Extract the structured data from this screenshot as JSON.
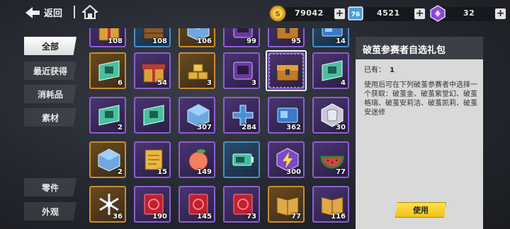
{
  "topbar": {
    "back_label": "返回",
    "resources": [
      {
        "name": "gold-coin",
        "value": "79042"
      },
      {
        "name": "ticket",
        "value": "4521"
      },
      {
        "name": "crystal",
        "value": "32"
      }
    ]
  },
  "sidebar": {
    "items": [
      {
        "label": "全部",
        "active": true
      },
      {
        "label": "最近获得",
        "active": false
      },
      {
        "label": "消耗品",
        "active": false
      },
      {
        "label": "素材",
        "active": false
      }
    ],
    "lower_items": [
      {
        "label": "零件"
      },
      {
        "label": "外观"
      }
    ]
  },
  "inventory": {
    "rows": [
      [
        {
          "qty": "108",
          "rarity": "purple",
          "icon": "gift-box-icon"
        },
        {
          "qty": "108",
          "rarity": "blue",
          "icon": "crate-icon"
        },
        {
          "qty": "106",
          "rarity": "gold",
          "icon": "cube-icon"
        },
        {
          "qty": "99",
          "rarity": "purple",
          "icon": "scanner-icon"
        },
        {
          "qty": "95",
          "rarity": "purple",
          "icon": "chest-icon"
        },
        {
          "qty": "14",
          "rarity": "blue",
          "icon": "card-icon"
        }
      ],
      [
        {
          "qty": "6",
          "rarity": "gold",
          "icon": "ticket-icon"
        },
        {
          "qty": "54",
          "rarity": "purple",
          "icon": "gift-box-icon"
        },
        {
          "qty": "3",
          "rarity": "gold",
          "icon": "gold-bricks-icon"
        },
        {
          "qty": "3",
          "rarity": "purple",
          "icon": "scanner-icon"
        },
        {
          "qty": "",
          "rarity": "purple",
          "icon": "chest-icon"
        },
        {
          "qty": "4",
          "rarity": "purple",
          "icon": "ticket-icon"
        }
      ],
      [
        {
          "qty": "2",
          "rarity": "purple",
          "icon": "ticket-icon"
        },
        {
          "qty": "",
          "rarity": "purple",
          "icon": "ticket-icon"
        },
        {
          "qty": "307",
          "rarity": "purple",
          "icon": "cube-icon"
        },
        {
          "qty": "284",
          "rarity": "purple",
          "icon": "cross-chip-icon"
        },
        {
          "qty": "362",
          "rarity": "purple",
          "icon": "card-icon"
        },
        {
          "qty": "30",
          "rarity": "purple",
          "icon": "hexagon-shirt-icon"
        }
      ],
      [
        {
          "qty": "2",
          "rarity": "gold",
          "icon": "cube-icon"
        },
        {
          "qty": "15",
          "rarity": "purple",
          "icon": "manual-icon"
        },
        {
          "qty": "149",
          "rarity": "purple",
          "icon": "peach-icon"
        },
        {
          "qty": "",
          "rarity": "blue",
          "icon": "battery-icon"
        },
        {
          "qty": "300",
          "rarity": "purple",
          "icon": "lightning-hex-icon"
        },
        {
          "qty": "77",
          "rarity": "purple",
          "icon": "watermelon-icon"
        }
      ],
      [
        {
          "qty": "36",
          "rarity": "gold",
          "icon": "snowflake-icon"
        },
        {
          "qty": "190",
          "rarity": "purple",
          "icon": "red-card-icon"
        },
        {
          "qty": "145",
          "rarity": "purple",
          "icon": "red-card-icon"
        },
        {
          "qty": "73",
          "rarity": "purple",
          "icon": "red-card-icon"
        },
        {
          "qty": "77",
          "rarity": "gold",
          "icon": "book-icon"
        },
        {
          "qty": "116",
          "rarity": "purple",
          "icon": "book-icon"
        }
      ]
    ]
  },
  "detail": {
    "title": "破茧参赛者自选礼包",
    "owned_label": "已有：",
    "owned_value": "1",
    "description": "使用后可在下列破茧参赛者中选择一个获取：破茧金、破茧紫堂幻、破茧格瑞、破茧安莉洁、破茧凯莉、破茧安迷修",
    "use_label": "使用"
  },
  "colors": {
    "gold": "#c98d2e",
    "purple": "#8c5fd0",
    "blue": "#4c8fc8",
    "use_button": "#f1c21a"
  }
}
